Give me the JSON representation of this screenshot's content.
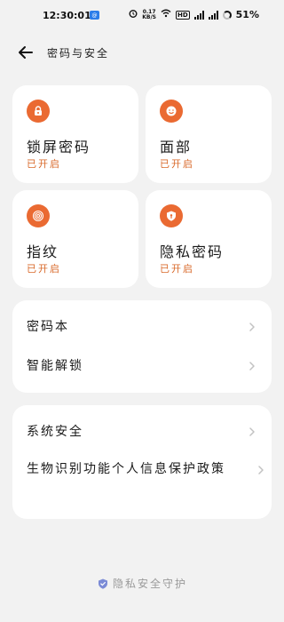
{
  "status_bar": {
    "time": "12:30:01",
    "app_badge": "@",
    "speed_value": "0.17",
    "speed_unit": "KB/S",
    "hd_label": "HD",
    "battery": "51%"
  },
  "header": {
    "title": "密码与安全"
  },
  "tiles": [
    {
      "title": "锁屏密码",
      "status": "已开启",
      "icon": "lock-icon"
    },
    {
      "title": "面部",
      "status": "已开启",
      "icon": "face-icon"
    },
    {
      "title": "指纹",
      "status": "已开启",
      "icon": "fingerprint-icon"
    },
    {
      "title": "隐私密码",
      "status": "已开启",
      "icon": "privacy-shield-icon"
    }
  ],
  "card1": {
    "items": [
      "密码本",
      "智能解锁"
    ]
  },
  "card2": {
    "items": [
      "系统安全",
      "生物识别功能个人信息保护政策"
    ]
  },
  "footer": {
    "label": "隐私安全守护"
  },
  "colors": {
    "accent": "#ea6a32",
    "status_text": "#d96a2b",
    "background": "#f2f2f2"
  }
}
